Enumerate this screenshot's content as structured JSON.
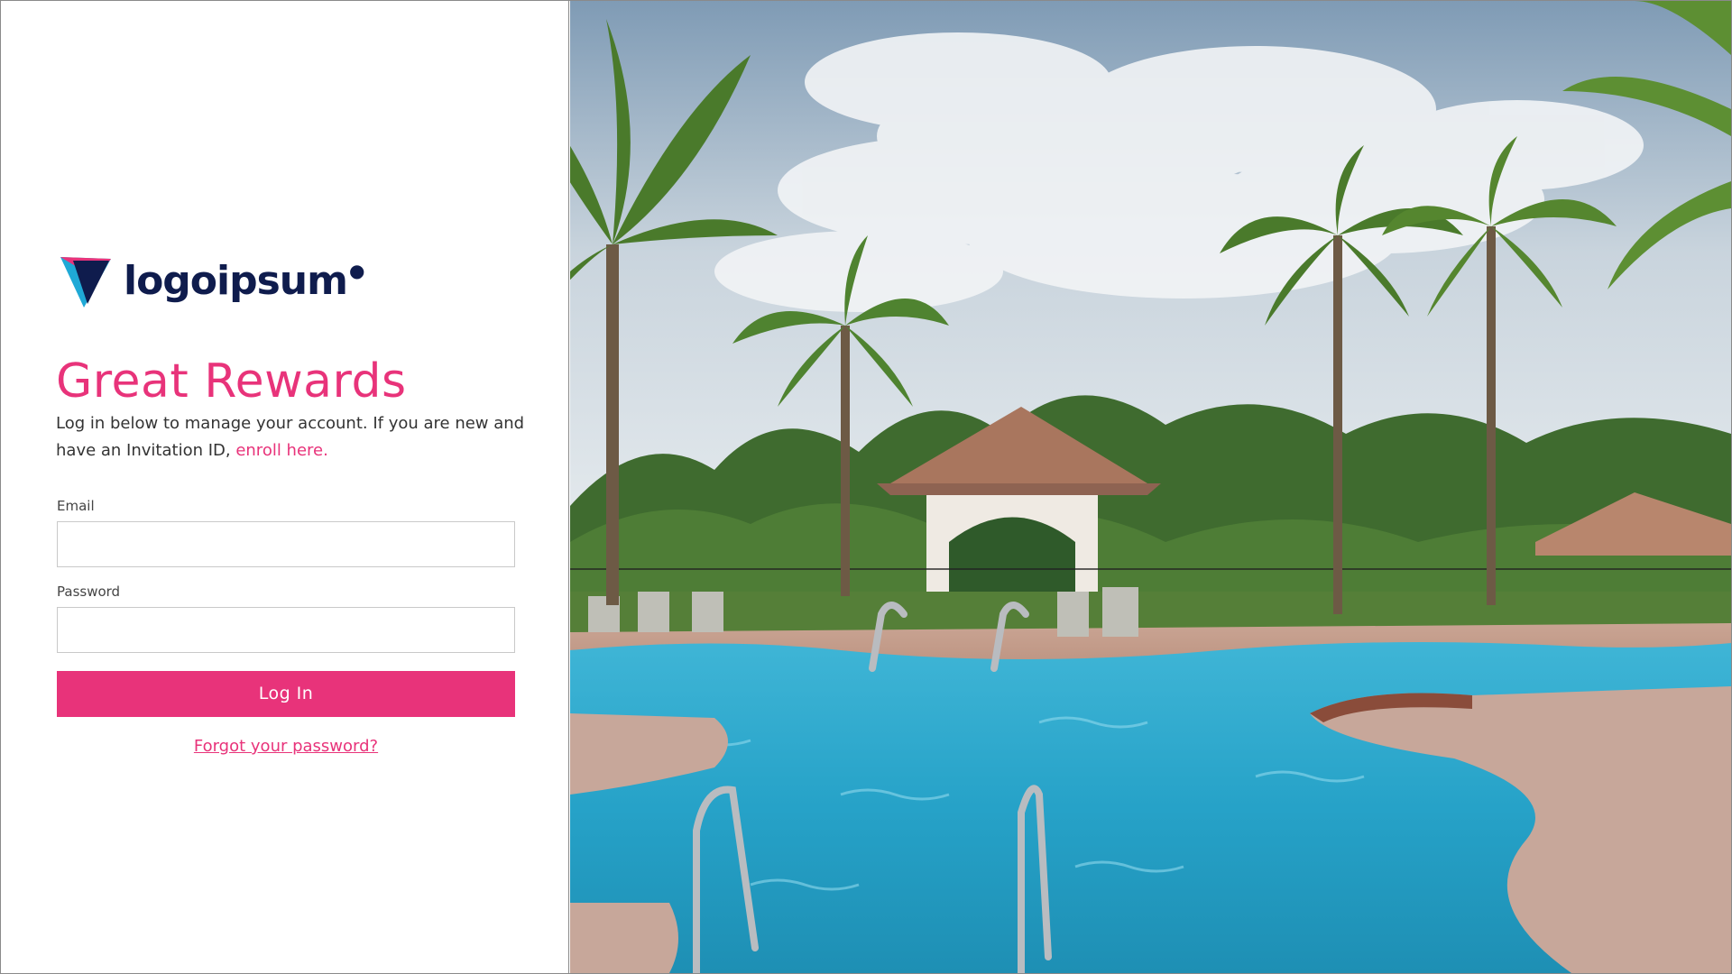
{
  "brand": {
    "name": "logoipsum",
    "colors": {
      "accent": "#e8337a",
      "navy": "#0f1c4d",
      "teal": "#1fa9d6"
    }
  },
  "login": {
    "headline": "Great Rewards",
    "intro_text": "Log in below to manage your account. If you are new and have an Invitation ID, ",
    "enroll_link": "enroll here.",
    "email_label": "Email",
    "email_value": "",
    "password_label": "Password",
    "password_value": "",
    "login_button": "Log In",
    "forgot_link": "Forgot your password?"
  },
  "hero_image": {
    "icon": "resort-pool-photo"
  }
}
